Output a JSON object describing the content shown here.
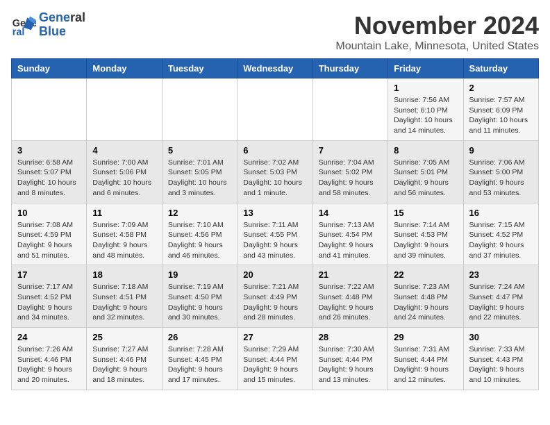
{
  "header": {
    "logo_line1": "General",
    "logo_line2": "Blue",
    "month_title": "November 2024",
    "location": "Mountain Lake, Minnesota, United States"
  },
  "weekdays": [
    "Sunday",
    "Monday",
    "Tuesday",
    "Wednesday",
    "Thursday",
    "Friday",
    "Saturday"
  ],
  "weeks": [
    [
      {
        "day": "",
        "info": ""
      },
      {
        "day": "",
        "info": ""
      },
      {
        "day": "",
        "info": ""
      },
      {
        "day": "",
        "info": ""
      },
      {
        "day": "",
        "info": ""
      },
      {
        "day": "1",
        "info": "Sunrise: 7:56 AM\nSunset: 6:10 PM\nDaylight: 10 hours and 14 minutes."
      },
      {
        "day": "2",
        "info": "Sunrise: 7:57 AM\nSunset: 6:09 PM\nDaylight: 10 hours and 11 minutes."
      }
    ],
    [
      {
        "day": "3",
        "info": "Sunrise: 6:58 AM\nSunset: 5:07 PM\nDaylight: 10 hours and 8 minutes."
      },
      {
        "day": "4",
        "info": "Sunrise: 7:00 AM\nSunset: 5:06 PM\nDaylight: 10 hours and 6 minutes."
      },
      {
        "day": "5",
        "info": "Sunrise: 7:01 AM\nSunset: 5:05 PM\nDaylight: 10 hours and 3 minutes."
      },
      {
        "day": "6",
        "info": "Sunrise: 7:02 AM\nSunset: 5:03 PM\nDaylight: 10 hours and 1 minute."
      },
      {
        "day": "7",
        "info": "Sunrise: 7:04 AM\nSunset: 5:02 PM\nDaylight: 9 hours and 58 minutes."
      },
      {
        "day": "8",
        "info": "Sunrise: 7:05 AM\nSunset: 5:01 PM\nDaylight: 9 hours and 56 minutes."
      },
      {
        "day": "9",
        "info": "Sunrise: 7:06 AM\nSunset: 5:00 PM\nDaylight: 9 hours and 53 minutes."
      }
    ],
    [
      {
        "day": "10",
        "info": "Sunrise: 7:08 AM\nSunset: 4:59 PM\nDaylight: 9 hours and 51 minutes."
      },
      {
        "day": "11",
        "info": "Sunrise: 7:09 AM\nSunset: 4:58 PM\nDaylight: 9 hours and 48 minutes."
      },
      {
        "day": "12",
        "info": "Sunrise: 7:10 AM\nSunset: 4:56 PM\nDaylight: 9 hours and 46 minutes."
      },
      {
        "day": "13",
        "info": "Sunrise: 7:11 AM\nSunset: 4:55 PM\nDaylight: 9 hours and 43 minutes."
      },
      {
        "day": "14",
        "info": "Sunrise: 7:13 AM\nSunset: 4:54 PM\nDaylight: 9 hours and 41 minutes."
      },
      {
        "day": "15",
        "info": "Sunrise: 7:14 AM\nSunset: 4:53 PM\nDaylight: 9 hours and 39 minutes."
      },
      {
        "day": "16",
        "info": "Sunrise: 7:15 AM\nSunset: 4:52 PM\nDaylight: 9 hours and 37 minutes."
      }
    ],
    [
      {
        "day": "17",
        "info": "Sunrise: 7:17 AM\nSunset: 4:52 PM\nDaylight: 9 hours and 34 minutes."
      },
      {
        "day": "18",
        "info": "Sunrise: 7:18 AM\nSunset: 4:51 PM\nDaylight: 9 hours and 32 minutes."
      },
      {
        "day": "19",
        "info": "Sunrise: 7:19 AM\nSunset: 4:50 PM\nDaylight: 9 hours and 30 minutes."
      },
      {
        "day": "20",
        "info": "Sunrise: 7:21 AM\nSunset: 4:49 PM\nDaylight: 9 hours and 28 minutes."
      },
      {
        "day": "21",
        "info": "Sunrise: 7:22 AM\nSunset: 4:48 PM\nDaylight: 9 hours and 26 minutes."
      },
      {
        "day": "22",
        "info": "Sunrise: 7:23 AM\nSunset: 4:48 PM\nDaylight: 9 hours and 24 minutes."
      },
      {
        "day": "23",
        "info": "Sunrise: 7:24 AM\nSunset: 4:47 PM\nDaylight: 9 hours and 22 minutes."
      }
    ],
    [
      {
        "day": "24",
        "info": "Sunrise: 7:26 AM\nSunset: 4:46 PM\nDaylight: 9 hours and 20 minutes."
      },
      {
        "day": "25",
        "info": "Sunrise: 7:27 AM\nSunset: 4:46 PM\nDaylight: 9 hours and 18 minutes."
      },
      {
        "day": "26",
        "info": "Sunrise: 7:28 AM\nSunset: 4:45 PM\nDaylight: 9 hours and 17 minutes."
      },
      {
        "day": "27",
        "info": "Sunrise: 7:29 AM\nSunset: 4:44 PM\nDaylight: 9 hours and 15 minutes."
      },
      {
        "day": "28",
        "info": "Sunrise: 7:30 AM\nSunset: 4:44 PM\nDaylight: 9 hours and 13 minutes."
      },
      {
        "day": "29",
        "info": "Sunrise: 7:31 AM\nSunset: 4:44 PM\nDaylight: 9 hours and 12 minutes."
      },
      {
        "day": "30",
        "info": "Sunrise: 7:33 AM\nSunset: 4:43 PM\nDaylight: 9 hours and 10 minutes."
      }
    ]
  ]
}
